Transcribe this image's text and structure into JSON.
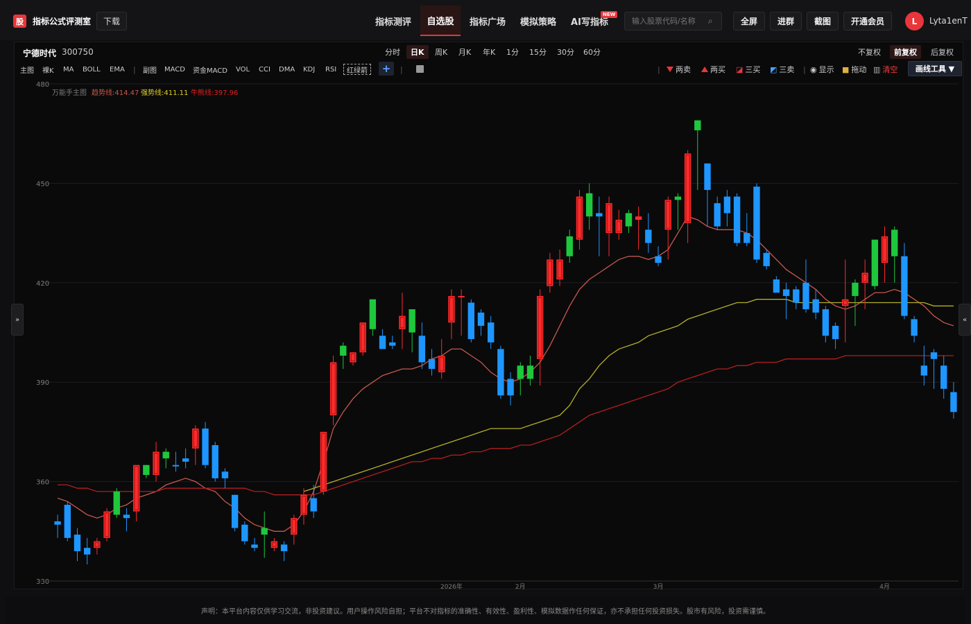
{
  "app": {
    "logo_glyph": "股",
    "title": "指标公式评测室",
    "download": "下载"
  },
  "nav": {
    "items": [
      "指标测评",
      "自选股",
      "指标广场",
      "模拟策略",
      "AI写指标"
    ],
    "active": "自选股",
    "new_badge": "NEW"
  },
  "search": {
    "placeholder": "输入股票代码/名称"
  },
  "top_buttons": {
    "fullscreen": "全屏",
    "join_group": "进群",
    "screenshot": "截图",
    "membership": "开通会员"
  },
  "user": {
    "avatar_letter": "L",
    "name": "Lyta1enT"
  },
  "stock": {
    "name": "宁德时代",
    "code": "300750"
  },
  "periods": [
    "分时",
    "日K",
    "周K",
    "月K",
    "年K",
    "1分",
    "15分",
    "30分",
    "60分"
  ],
  "active_period": "日K",
  "adjust": [
    "不复权",
    "前复权",
    "后复权"
  ],
  "active_adjust": "前复权",
  "indicators_main": [
    "主图",
    "裸K",
    "MA",
    "BOLL",
    "EMA"
  ],
  "indicators_sub": [
    "副图",
    "MACD",
    "资金MACD",
    "VOL",
    "CCI",
    "DMA",
    "KDJ",
    "RSI",
    "红绿箭"
  ],
  "plus": "+",
  "tools": {
    "sell_two": "两卖",
    "buy_two": "两买",
    "buy_three": "三买",
    "sell_three": "三卖",
    "show": "显示",
    "drag": "拖动",
    "clear": "清空",
    "draw_tools": "画线工具 ▼"
  },
  "legend": {
    "name": "万能手主图",
    "trend_label": "趋势线:",
    "trend_value": "414.47",
    "strong_label": "强势线:",
    "strong_value": "411.11",
    "bull_label": "牛熊线:",
    "bull_value": "397.96"
  },
  "colors": {
    "up": "#ff2b2b",
    "down": "#1e96ff",
    "green": "#1ec83c",
    "yellow": "#ffd400",
    "trend": "#c8584c",
    "strong": "#b4b028",
    "bull": "#b41e1e"
  },
  "disclaimer": "声明：本平台内容仅供学习交流，非投资建议。用户操作风险自担；平台不对指标的准确性、有效性、盈利性、模拟数据作任何保证，亦不承担任何投资损失。股市有风险，投资需谨慎。",
  "chart_data": {
    "type": "candlestick",
    "ylim": [
      330,
      480
    ],
    "y_ticks": [
      330,
      360,
      390,
      420,
      450,
      480
    ],
    "x_ticks": [
      {
        "index": 40,
        "label": "2026年"
      },
      {
        "index": 47,
        "label": "2月"
      },
      {
        "index": 61,
        "label": "3月"
      },
      {
        "index": 84,
        "label": "4月"
      }
    ],
    "candles": [
      {
        "o": 348,
        "h": 350,
        "l": 343,
        "c": 347,
        "k": "d"
      },
      {
        "o": 353,
        "h": 354,
        "l": 342,
        "c": 343,
        "k": "d"
      },
      {
        "o": 344,
        "h": 346,
        "l": 336,
        "c": 339,
        "k": "d"
      },
      {
        "o": 340,
        "h": 343,
        "l": 335,
        "c": 338,
        "k": "d"
      },
      {
        "o": 340,
        "h": 343,
        "l": 338,
        "c": 342,
        "k": "u"
      },
      {
        "o": 343,
        "h": 352,
        "l": 342,
        "c": 351,
        "k": "u"
      },
      {
        "o": 350,
        "h": 358,
        "l": 349,
        "c": 357,
        "k": "g"
      },
      {
        "o": 350,
        "h": 352,
        "l": 345,
        "c": 349,
        "k": "d"
      },
      {
        "o": 351,
        "h": 363,
        "l": 348,
        "c": 365,
        "k": "u"
      },
      {
        "o": 362,
        "h": 365,
        "l": 361,
        "c": 365,
        "k": "g"
      },
      {
        "o": 362,
        "h": 372,
        "l": 360,
        "c": 369,
        "k": "u"
      },
      {
        "o": 367,
        "h": 370,
        "l": 364,
        "c": 369,
        "k": "g"
      },
      {
        "o": 365,
        "h": 369,
        "l": 363,
        "c": 365,
        "k": "d"
      },
      {
        "o": 366,
        "h": 370,
        "l": 364,
        "c": 367,
        "k": "d"
      },
      {
        "o": 370,
        "h": 377,
        "l": 365,
        "c": 376,
        "k": "u"
      },
      {
        "o": 376,
        "h": 378,
        "l": 364,
        "c": 365,
        "k": "d"
      },
      {
        "o": 371,
        "h": 372,
        "l": 360,
        "c": 361,
        "k": "d"
      },
      {
        "o": 363,
        "h": 364,
        "l": 358,
        "c": 361,
        "k": "d"
      },
      {
        "o": 356,
        "h": 356,
        "l": 345,
        "c": 346,
        "k": "d"
      },
      {
        "o": 347,
        "h": 348,
        "l": 341,
        "c": 342,
        "k": "d"
      },
      {
        "o": 341,
        "h": 343,
        "l": 339,
        "c": 340,
        "k": "d"
      },
      {
        "o": 344,
        "h": 351,
        "l": 337,
        "c": 346,
        "k": "g"
      },
      {
        "o": 342,
        "h": 343,
        "l": 339,
        "c": 340,
        "k": "u"
      },
      {
        "o": 341,
        "h": 342,
        "l": 336,
        "c": 339,
        "k": "d"
      },
      {
        "o": 344,
        "h": 350,
        "l": 341,
        "c": 349,
        "k": "u"
      },
      {
        "o": 350,
        "h": 358,
        "l": 347,
        "c": 356,
        "k": "u"
      },
      {
        "o": 355,
        "h": 359,
        "l": 349,
        "c": 351,
        "k": "d"
      },
      {
        "o": 357,
        "h": 365,
        "l": 356,
        "c": 375,
        "k": "u"
      },
      {
        "o": 380,
        "h": 398,
        "l": 377,
        "c": 396,
        "k": "u"
      },
      {
        "o": 398,
        "h": 402,
        "l": 394,
        "c": 401,
        "k": "g"
      },
      {
        "o": 396,
        "h": 399,
        "l": 395,
        "c": 399,
        "k": "u"
      },
      {
        "o": 399,
        "h": 405,
        "l": 398,
        "c": 408,
        "k": "u"
      },
      {
        "o": 406,
        "h": 412,
        "l": 404,
        "c": 415,
        "k": "g"
      },
      {
        "o": 404,
        "h": 406,
        "l": 402,
        "c": 400,
        "k": "d"
      },
      {
        "o": 402,
        "h": 404,
        "l": 400,
        "c": 401,
        "k": "d"
      },
      {
        "o": 410,
        "h": 417,
        "l": 400,
        "c": 406,
        "k": "u"
      },
      {
        "o": 405,
        "h": 410,
        "l": 399,
        "c": 412,
        "k": "g"
      },
      {
        "o": 404,
        "h": 408,
        "l": 394,
        "c": 396,
        "k": "d"
      },
      {
        "o": 397,
        "h": 400,
        "l": 392,
        "c": 394,
        "k": "d"
      },
      {
        "o": 398,
        "h": 403,
        "l": 391,
        "c": 393,
        "k": "u"
      },
      {
        "o": 408,
        "h": 418,
        "l": 403,
        "c": 416,
        "k": "u"
      },
      {
        "o": 416,
        "h": 418,
        "l": 404,
        "c": 416,
        "k": "u"
      },
      {
        "o": 414,
        "h": 415,
        "l": 402,
        "c": 403,
        "k": "d"
      },
      {
        "o": 411,
        "h": 412,
        "l": 404,
        "c": 407,
        "k": "d"
      },
      {
        "o": 408,
        "h": 410,
        "l": 400,
        "c": 402,
        "k": "d"
      },
      {
        "o": 400,
        "h": 401,
        "l": 385,
        "c": 386,
        "k": "d"
      },
      {
        "o": 391,
        "h": 393,
        "l": 383,
        "c": 386,
        "k": "d"
      },
      {
        "o": 391,
        "h": 396,
        "l": 386,
        "c": 395,
        "k": "g"
      },
      {
        "o": 395,
        "h": 398,
        "l": 389,
        "c": 391,
        "k": "g"
      },
      {
        "o": 397,
        "h": 418,
        "l": 389,
        "c": 416,
        "k": "u"
      },
      {
        "o": 419,
        "h": 429,
        "l": 417,
        "c": 427,
        "k": "u"
      },
      {
        "o": 421,
        "h": 430,
        "l": 419,
        "c": 427,
        "k": "u"
      },
      {
        "o": 428,
        "h": 436,
        "l": 426,
        "c": 434,
        "k": "g"
      },
      {
        "o": 433,
        "h": 448,
        "l": 430,
        "c": 446,
        "k": "u"
      },
      {
        "o": 447,
        "h": 450,
        "l": 436,
        "c": 440,
        "k": "g"
      },
      {
        "o": 440,
        "h": 446,
        "l": 428,
        "c": 441,
        "k": "d"
      },
      {
        "o": 444,
        "h": 446,
        "l": 428,
        "c": 435,
        "k": "u"
      },
      {
        "o": 439,
        "h": 442,
        "l": 433,
        "c": 435,
        "k": "u"
      },
      {
        "o": 437,
        "h": 442,
        "l": 435,
        "c": 441,
        "k": "g"
      },
      {
        "o": 440,
        "h": 443,
        "l": 430,
        "c": 439,
        "k": "u"
      },
      {
        "o": 436,
        "h": 441,
        "l": 429,
        "c": 432,
        "k": "d"
      },
      {
        "o": 428,
        "h": 431,
        "l": 425,
        "c": 426,
        "k": "d"
      },
      {
        "o": 436,
        "h": 446,
        "l": 427,
        "c": 445,
        "k": "u"
      },
      {
        "o": 445,
        "h": 447,
        "l": 436,
        "c": 446,
        "k": "g"
      },
      {
        "o": 438,
        "h": 460,
        "l": 432,
        "c": 459,
        "k": "u"
      },
      {
        "o": 466,
        "h": 469,
        "l": 448,
        "c": 469,
        "k": "g"
      },
      {
        "o": 448,
        "h": 451,
        "l": 437,
        "c": 456,
        "k": "d"
      },
      {
        "o": 444,
        "h": 446,
        "l": 436,
        "c": 437,
        "k": "d"
      },
      {
        "o": 441,
        "h": 448,
        "l": 437,
        "c": 446,
        "k": "d"
      },
      {
        "o": 446,
        "h": 447,
        "l": 431,
        "c": 432,
        "k": "d"
      },
      {
        "o": 435,
        "h": 441,
        "l": 431,
        "c": 432,
        "k": "d"
      },
      {
        "o": 449,
        "h": 450,
        "l": 426,
        "c": 427,
        "k": "d"
      },
      {
        "o": 429,
        "h": 430,
        "l": 424,
        "c": 425,
        "k": "d"
      },
      {
        "o": 421,
        "h": 422,
        "l": 418,
        "c": 417,
        "k": "d"
      },
      {
        "o": 418,
        "h": 420,
        "l": 409,
        "c": 416,
        "k": "d"
      },
      {
        "o": 418,
        "h": 419,
        "l": 412,
        "c": 414,
        "k": "d"
      },
      {
        "o": 420,
        "h": 427,
        "l": 411,
        "c": 412,
        "k": "d"
      },
      {
        "o": 415,
        "h": 418,
        "l": 409,
        "c": 411,
        "k": "d"
      },
      {
        "o": 412,
        "h": 413,
        "l": 402,
        "c": 404,
        "k": "d"
      },
      {
        "o": 407,
        "h": 408,
        "l": 400,
        "c": 403,
        "k": "d"
      },
      {
        "o": 415,
        "h": 427,
        "l": 402,
        "c": 413,
        "k": "u"
      },
      {
        "o": 416,
        "h": 421,
        "l": 407,
        "c": 420,
        "k": "g"
      },
      {
        "o": 420,
        "h": 427,
        "l": 412,
        "c": 423,
        "k": "u"
      },
      {
        "o": 419,
        "h": 433,
        "l": 418,
        "c": 433,
        "k": "g"
      },
      {
        "o": 426,
        "h": 437,
        "l": 420,
        "c": 434,
        "k": "u"
      },
      {
        "o": 436,
        "h": 437,
        "l": 420,
        "c": 428,
        "k": "g"
      },
      {
        "o": 428,
        "h": 432,
        "l": 409,
        "c": 410,
        "k": "d"
      },
      {
        "o": 409,
        "h": 410,
        "l": 402,
        "c": 404,
        "k": "d"
      },
      {
        "o": 395,
        "h": 401,
        "l": 389,
        "c": 392,
        "k": "d"
      },
      {
        "o": 399,
        "h": 400,
        "l": 388,
        "c": 397,
        "k": "d"
      },
      {
        "o": 395,
        "h": 398,
        "l": 385,
        "c": 388,
        "k": "d"
      },
      {
        "o": 387,
        "h": 390,
        "l": 379,
        "c": 381,
        "k": "d"
      }
    ],
    "series": [
      {
        "name": "趋势线",
        "values": [
          355,
          354,
          352,
          350,
          349,
          350,
          352,
          353,
          355,
          356,
          357,
          359,
          360,
          361,
          360,
          358,
          357,
          354,
          352,
          349,
          347,
          346,
          345,
          345,
          347,
          351,
          357,
          366,
          376,
          381,
          385,
          388,
          390,
          392,
          393,
          394,
          394,
          395,
          397,
          398,
          400,
          400,
          398,
          396,
          393,
          391,
          390,
          391,
          393,
          396,
          401,
          407,
          413,
          418,
          421,
          423,
          425,
          427,
          428,
          428,
          427,
          428,
          430,
          435,
          440,
          439,
          437,
          436,
          436,
          436,
          435,
          433,
          430,
          427,
          424,
          422,
          420,
          418,
          415,
          413,
          412,
          413,
          415,
          417,
          417,
          418,
          417,
          415,
          413,
          410,
          408,
          407
        ]
      },
      {
        "name": "强势线",
        "values": [
          null,
          null,
          null,
          null,
          null,
          null,
          null,
          null,
          null,
          null,
          null,
          null,
          null,
          null,
          null,
          null,
          null,
          null,
          null,
          null,
          null,
          null,
          null,
          null,
          null,
          357,
          358,
          359,
          360,
          361,
          362,
          363,
          364,
          365,
          366,
          367,
          368,
          369,
          370,
          371,
          372,
          373,
          374,
          375,
          376,
          376,
          376,
          376,
          377,
          378,
          379,
          380,
          383,
          388,
          391,
          395,
          398,
          400,
          401,
          402,
          404,
          405,
          406,
          407,
          409,
          410,
          411,
          412,
          413,
          414,
          414,
          415,
          415,
          415,
          415,
          414,
          414,
          414,
          414,
          414,
          414,
          414,
          414,
          414,
          414,
          414,
          414,
          414,
          414,
          413,
          413,
          413
        ]
      },
      {
        "name": "牛熊线",
        "values": [
          359,
          359,
          358,
          358,
          357,
          357,
          357,
          357,
          357,
          357,
          357,
          358,
          358,
          358,
          358,
          358,
          358,
          358,
          358,
          358,
          357,
          357,
          356,
          356,
          356,
          356,
          356,
          357,
          358,
          359,
          360,
          361,
          362,
          363,
          364,
          365,
          366,
          366,
          367,
          367,
          368,
          368,
          369,
          369,
          370,
          370,
          370,
          371,
          371,
          372,
          373,
          374,
          376,
          378,
          380,
          381,
          382,
          383,
          384,
          385,
          386,
          387,
          388,
          390,
          391,
          392,
          393,
          394,
          394,
          395,
          395,
          396,
          396,
          396,
          397,
          397,
          397,
          397,
          397,
          397,
          398,
          398,
          398,
          398,
          398,
          398,
          398,
          398,
          398,
          398,
          398,
          398
        ]
      }
    ]
  }
}
